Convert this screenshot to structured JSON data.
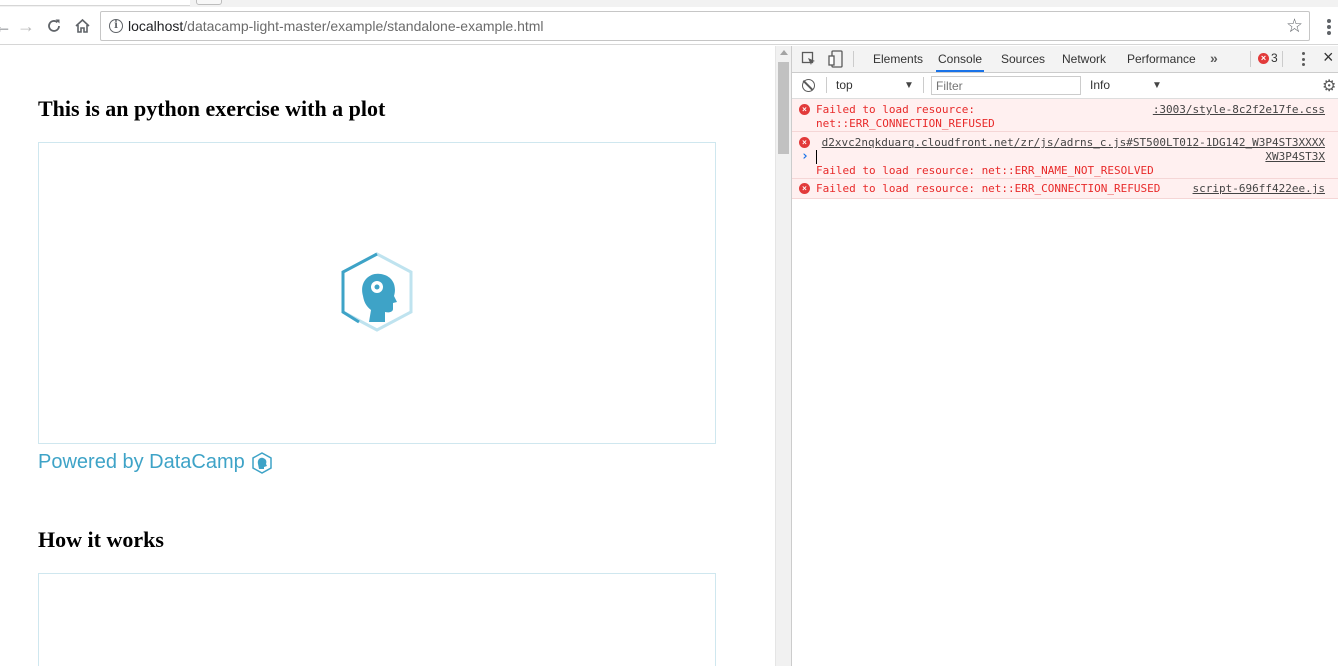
{
  "browser": {
    "url_host": "localhost",
    "url_path": "/datacamp-light-master/example/standalone-example.html"
  },
  "page": {
    "heading1": "This is an python exercise with a plot",
    "powered_by": "Powered by DataCamp",
    "heading2": "How it works"
  },
  "devtools": {
    "tabs": [
      "Elements",
      "Console",
      "Sources",
      "Network",
      "Performance"
    ],
    "active_tab": "Console",
    "more": "»",
    "error_count": "3",
    "context": "top",
    "filter_placeholder": "Filter",
    "level": "Info",
    "messages": [
      {
        "line1": "Failed to load resource:",
        "line2": "net::ERR_CONNECTION_REFUSED",
        "source": ":3003/style-8c2f2e17fe.css"
      },
      {
        "source1": "d2xvc2nqkduarq.cloudfront.net/zr/js/adrns_c.js#ST500LT012-1DG142_W3P4ST3XXXX",
        "source2": "XW3P4ST3X",
        "line": "Failed to load resource: net::ERR_NAME_NOT_RESOLVED"
      },
      {
        "line": "Failed to load resource: net::ERR_CONNECTION_REFUSED",
        "source": "script-696ff422ee.js"
      }
    ],
    "prompt": "›"
  },
  "colors": {
    "accent": "#3ea3c7",
    "error_text": "#e82a2a",
    "error_bg": "#fff0f0",
    "tab_active": "#1a73e8"
  }
}
